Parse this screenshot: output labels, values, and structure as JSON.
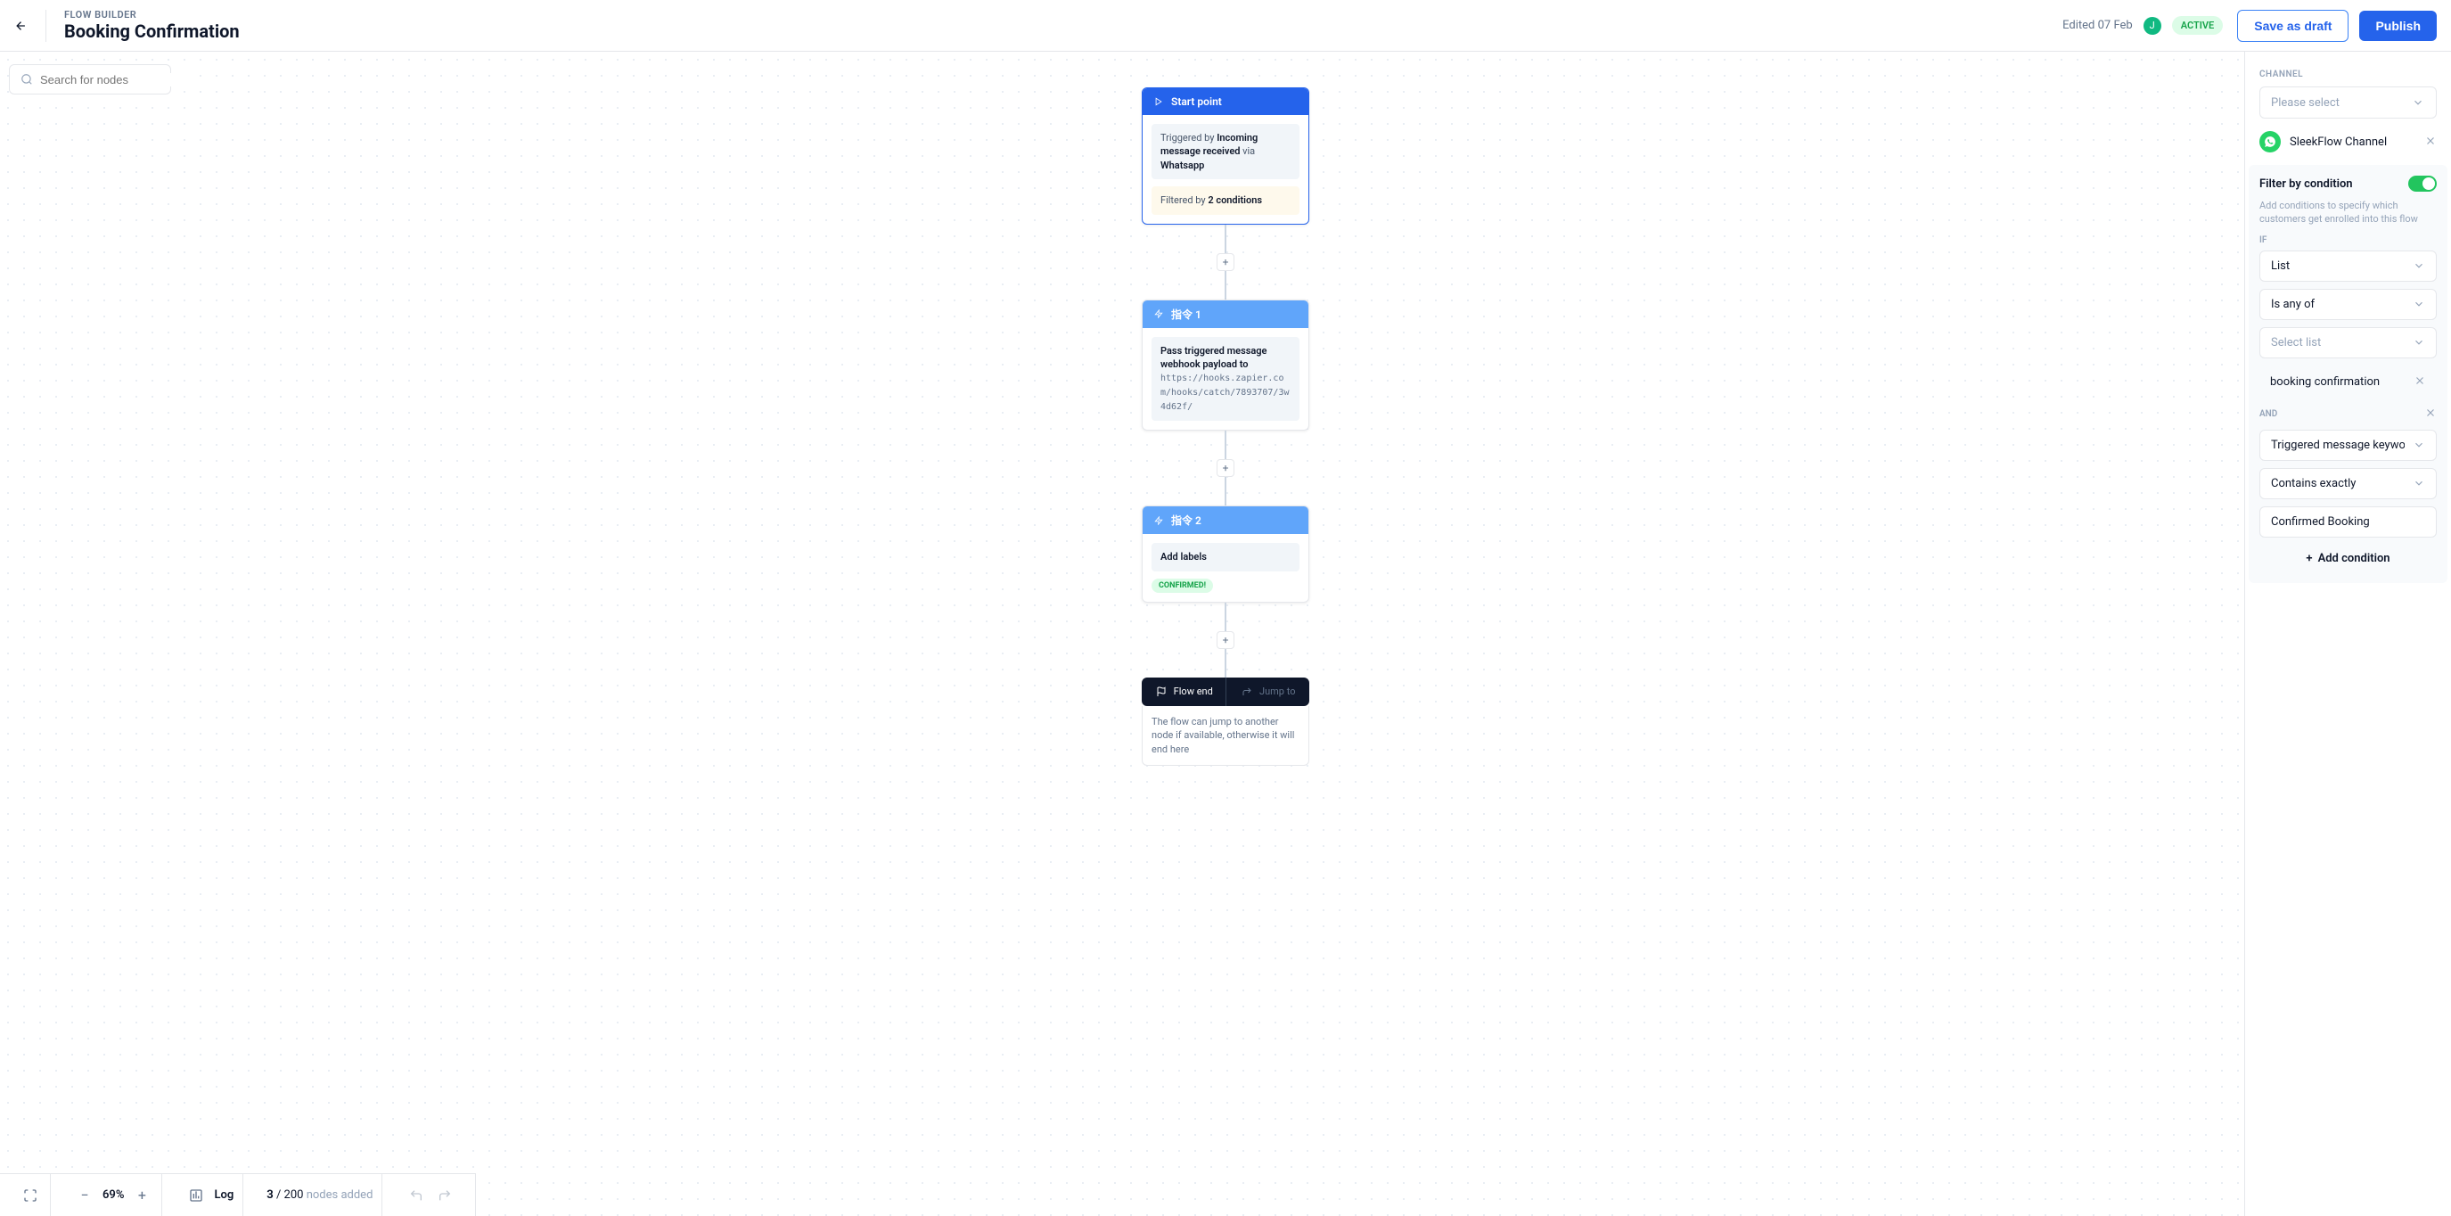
{
  "header": {
    "subtitle": "FLOW BUILDER",
    "title": "Booking Confirmation",
    "edited": "Edited 07 Feb",
    "avatar_letter": "J",
    "status": "ACTIVE",
    "save_draft": "Save as draft",
    "publish": "Publish"
  },
  "search": {
    "placeholder": "Search for nodes"
  },
  "nodes": {
    "start": {
      "title": "Start point",
      "trigger_prefix": "Triggered by ",
      "trigger_event": "Incoming message received",
      "trigger_via": " via ",
      "trigger_channel": "Whatsapp",
      "filter_prefix": "Filtered by ",
      "filter_count": "2 conditions"
    },
    "n1": {
      "title": "指令 1",
      "desc": "Pass triggered message webhook payload to",
      "url": "https://hooks.zapier.com/hooks/catch/7893707/3w4d62f/"
    },
    "n2": {
      "title": "指令 2",
      "desc": "Add labels",
      "tag": "CONFIRMED!"
    },
    "end": {
      "tab1": "Flow end",
      "tab2": "Jump to",
      "desc": "The flow can jump to another node if available, otherwise it will end here"
    }
  },
  "panel": {
    "channel_label": "CHANNEL",
    "channel_placeholder": "Please select",
    "channel_item": "SleekFlow Channel",
    "filter_title": "Filter by condition",
    "filter_desc": "Add conditions to specify which customers get enrolled into this flow",
    "if": "IF",
    "cond1_field": "List",
    "cond1_op": "Is any of",
    "cond1_val_ph": "Select list",
    "cond1_val": "booking confirmation",
    "and": "AND",
    "cond2_field": "Triggered message keywo",
    "cond2_op": "Contains exactly",
    "cond2_val": "Confirmed Booking",
    "add_cond": "Add condition"
  },
  "bottombar": {
    "zoom": "69%",
    "log": "Log",
    "count_n": "3",
    "count_total": "/ 200",
    "count_label": "nodes added"
  }
}
